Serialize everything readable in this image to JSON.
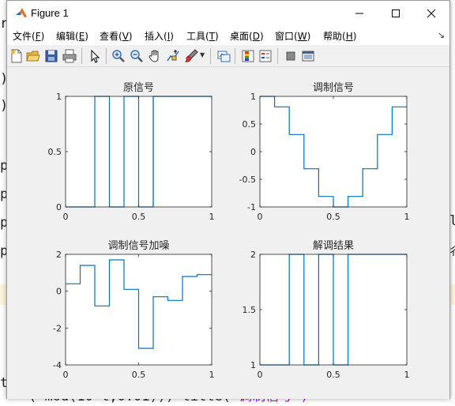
{
  "window": {
    "title": "Figure 1"
  },
  "menu": [
    {
      "label": "文件(",
      "acc": "F",
      "end": ")"
    },
    {
      "label": "编辑(",
      "acc": "E",
      "end": ")"
    },
    {
      "label": "查看(",
      "acc": "V",
      "end": ")"
    },
    {
      "label": "插入(",
      "acc": "I",
      "end": ")"
    },
    {
      "label": "工具(",
      "acc": "T",
      "end": ")"
    },
    {
      "label": "桌面(",
      "acc": "D",
      "end": ")"
    },
    {
      "label": "窗口(",
      "acc": "W",
      "end": ")"
    },
    {
      "label": "帮助(",
      "acc": "H",
      "end": ")"
    }
  ],
  "toolbar_icons": [
    "new-figure-icon",
    "open-file-icon",
    "save-icon",
    "print-icon",
    "pointer-icon",
    "zoom-in-icon",
    "zoom-out-icon",
    "pan-icon",
    "data-cursor-icon",
    "brush-icon",
    "link-plot-icon",
    "colorbar-icon",
    "legend-icon",
    "hide-plot-tools-icon",
    "show-plot-tools-icon"
  ],
  "background": {
    "bottom_line_code": "( mod(10*t,0.01))) title(",
    "bottom_line_string": "'调制信号')",
    "left_chars": [
      "r",
      "r",
      ")",
      ")",
      "p",
      "p",
      "p",
      "p",
      "t"
    ],
    "right_chars": [
      "l",
      "彳"
    ]
  },
  "colors": {
    "line": "#0072bd",
    "axes_bg": "#ffffff",
    "figure_bg": "#f0f0f0"
  },
  "chart_data": [
    {
      "type": "line",
      "title": "原信号",
      "xlim": [
        0,
        1
      ],
      "ylim": [
        0,
        1
      ],
      "xticks": [
        "0",
        "0.5",
        "1"
      ],
      "yticks": [
        "0",
        "0.5",
        "1"
      ],
      "x": [
        0,
        0.2,
        0.2,
        0.3,
        0.3,
        0.4,
        0.4,
        0.5,
        0.5,
        0.6,
        0.6,
        1.0
      ],
      "y": [
        0,
        0,
        1,
        1,
        0,
        0,
        1,
        1,
        0,
        0,
        1,
        1
      ],
      "extra_segments": [
        [
          0.6,
          0,
          0.6,
          1
        ]
      ]
    },
    {
      "type": "line",
      "title": "调制信号",
      "xlim": [
        0,
        1
      ],
      "ylim": [
        -1,
        1
      ],
      "xticks": [
        "0",
        "0.5",
        "1"
      ],
      "yticks": [
        "-1",
        "-0.5",
        "0",
        "0.5",
        "1"
      ],
      "x": [
        0,
        0.1,
        0.1,
        0.2,
        0.2,
        0.3,
        0.3,
        0.4,
        0.4,
        0.5,
        0.5,
        0.6,
        0.6,
        0.7,
        0.7,
        0.8,
        0.8,
        0.9,
        0.9,
        1.0
      ],
      "y": [
        1,
        1,
        0.81,
        0.81,
        0.31,
        0.31,
        -0.31,
        -0.31,
        -0.81,
        -0.81,
        -1,
        -1,
        -0.81,
        -0.81,
        -0.31,
        -0.31,
        0.31,
        0.31,
        0.81,
        0.81
      ]
    },
    {
      "type": "line",
      "title": "调制信号加噪",
      "xlim": [
        0,
        1
      ],
      "ylim": [
        -4,
        2
      ],
      "xticks": [
        "0",
        "0.5",
        "1"
      ],
      "yticks": [
        "-4",
        "-2",
        "0",
        "2"
      ],
      "x": [
        0,
        0.1,
        0.1,
        0.2,
        0.2,
        0.3,
        0.3,
        0.4,
        0.4,
        0.5,
        0.5,
        0.6,
        0.6,
        0.7,
        0.7,
        0.8,
        0.8,
        0.9,
        0.9,
        1.0
      ],
      "y": [
        0.4,
        0.4,
        1.4,
        1.4,
        -0.8,
        -0.8,
        1.7,
        1.7,
        0.1,
        0.1,
        -3.1,
        -3.1,
        -0.3,
        -0.3,
        -0.5,
        -0.5,
        0.8,
        0.8,
        0.9,
        0.9
      ]
    },
    {
      "type": "line",
      "title": "解调结果",
      "xlim": [
        0,
        1
      ],
      "ylim": [
        1,
        2
      ],
      "xticks": [
        "0",
        "0.5",
        "1"
      ],
      "yticks": [
        "1",
        "1.5",
        "2"
      ],
      "x": [
        0,
        0.2,
        0.2,
        0.3,
        0.3,
        0.4,
        0.4,
        0.5,
        0.5,
        0.6,
        0.6,
        1.0
      ],
      "y": [
        1,
        1,
        2,
        2,
        1,
        1,
        2,
        2,
        1,
        1,
        2,
        2
      ]
    }
  ]
}
